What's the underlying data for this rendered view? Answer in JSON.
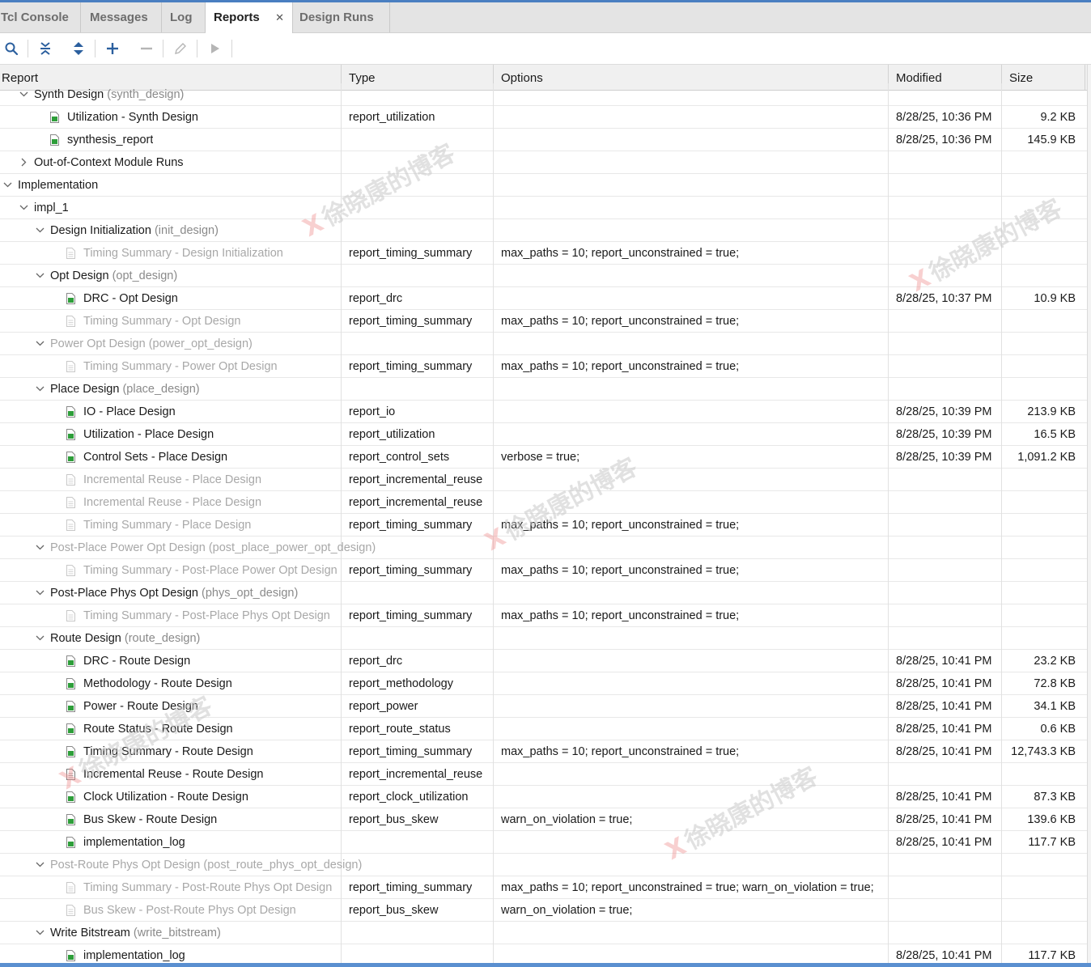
{
  "tabs": [
    {
      "label": "Tcl Console",
      "active": false
    },
    {
      "label": "Messages",
      "active": false
    },
    {
      "label": "Log",
      "active": false
    },
    {
      "label": "Reports",
      "active": true,
      "closable": true
    },
    {
      "label": "Design Runs",
      "active": false
    }
  ],
  "toolbar": {
    "buttons": [
      {
        "icon": "search-icon",
        "enabled": true
      },
      {
        "icon": "collapse-all-icon",
        "enabled": true
      },
      {
        "icon": "expand-all-icon",
        "enabled": true
      },
      {
        "icon": "add-icon",
        "enabled": true
      },
      {
        "icon": "remove-icon",
        "enabled": false
      },
      {
        "icon": "edit-pencil-icon",
        "enabled": false
      },
      {
        "icon": "run-icon",
        "enabled": false
      }
    ]
  },
  "columns": {
    "report": "Report",
    "type": "Type",
    "options": "Options",
    "modified": "Modified",
    "size": "Size"
  },
  "rows": [
    {
      "level": 1,
      "kind": "group",
      "expanded": true,
      "name": "Synth Design",
      "sub": "(synth_design)"
    },
    {
      "level": 2,
      "kind": "file",
      "status": "generated",
      "name": "Utilization - Synth Design",
      "type": "report_utilization",
      "options": "",
      "modified": "8/28/25, 10:36 PM",
      "size": "9.2 KB"
    },
    {
      "level": 2,
      "kind": "file",
      "status": "generated",
      "name": "synthesis_report",
      "type": "",
      "options": "",
      "modified": "8/28/25, 10:36 PM",
      "size": "145.9 KB"
    },
    {
      "level": 1,
      "kind": "group",
      "expanded": false,
      "name": "Out-of-Context Module Runs",
      "sub": ""
    },
    {
      "level": 0,
      "kind": "group",
      "expanded": true,
      "name": "Implementation",
      "sub": ""
    },
    {
      "level": 1,
      "kind": "group",
      "expanded": true,
      "name": "impl_1",
      "sub": ""
    },
    {
      "level": 2,
      "kind": "group",
      "expanded": true,
      "name": "Design Initialization",
      "sub": "(init_design)"
    },
    {
      "level": 3,
      "kind": "file",
      "status": "disabled",
      "name": "Timing Summary - Design Initialization",
      "type": "report_timing_summary",
      "options": "max_paths = 10; report_unconstrained = true;",
      "modified": "",
      "size": ""
    },
    {
      "level": 2,
      "kind": "group",
      "expanded": true,
      "name": "Opt Design",
      "sub": "(opt_design)"
    },
    {
      "level": 3,
      "kind": "file",
      "status": "generated",
      "name": "DRC - Opt Design",
      "type": "report_drc",
      "options": "",
      "modified": "8/28/25, 10:37 PM",
      "size": "10.9 KB"
    },
    {
      "level": 3,
      "kind": "file",
      "status": "disabled",
      "name": "Timing Summary - Opt Design",
      "type": "report_timing_summary",
      "options": "max_paths = 10; report_unconstrained = true;",
      "modified": "",
      "size": ""
    },
    {
      "level": 2,
      "kind": "group",
      "expanded": true,
      "disabled": true,
      "name": "Power Opt Design",
      "sub": "(power_opt_design)"
    },
    {
      "level": 3,
      "kind": "file",
      "status": "disabled",
      "name": "Timing Summary - Power Opt Design",
      "type": "report_timing_summary",
      "options": "max_paths = 10; report_unconstrained = true;",
      "modified": "",
      "size": ""
    },
    {
      "level": 2,
      "kind": "group",
      "expanded": true,
      "name": "Place Design",
      "sub": "(place_design)"
    },
    {
      "level": 3,
      "kind": "file",
      "status": "generated",
      "name": "IO - Place Design",
      "type": "report_io",
      "options": "",
      "modified": "8/28/25, 10:39 PM",
      "size": "213.9 KB"
    },
    {
      "level": 3,
      "kind": "file",
      "status": "generated",
      "name": "Utilization - Place Design",
      "type": "report_utilization",
      "options": "",
      "modified": "8/28/25, 10:39 PM",
      "size": "16.5 KB"
    },
    {
      "level": 3,
      "kind": "file",
      "status": "generated",
      "name": "Control Sets - Place Design",
      "type": "report_control_sets",
      "options": "verbose = true;",
      "modified": "8/28/25, 10:39 PM",
      "size": "1,091.2 KB"
    },
    {
      "level": 3,
      "kind": "file",
      "status": "disabled",
      "name": "Incremental Reuse - Place Design",
      "type": "report_incremental_reuse",
      "options": "",
      "modified": "",
      "size": ""
    },
    {
      "level": 3,
      "kind": "file",
      "status": "disabled",
      "name": "Incremental Reuse - Place Design",
      "type": "report_incremental_reuse",
      "options": "",
      "modified": "",
      "size": ""
    },
    {
      "level": 3,
      "kind": "file",
      "status": "disabled",
      "name": "Timing Summary - Place Design",
      "type": "report_timing_summary",
      "options": "max_paths = 10; report_unconstrained = true;",
      "modified": "",
      "size": ""
    },
    {
      "level": 2,
      "kind": "group",
      "expanded": true,
      "disabled": true,
      "name": "Post-Place Power Opt Design",
      "sub": "(post_place_power_opt_design)"
    },
    {
      "level": 3,
      "kind": "file",
      "status": "disabled",
      "name": "Timing Summary - Post-Place Power Opt Design",
      "type": "report_timing_summary",
      "options": "max_paths = 10; report_unconstrained = true;",
      "modified": "",
      "size": ""
    },
    {
      "level": 2,
      "kind": "group",
      "expanded": true,
      "name": "Post-Place Phys Opt Design",
      "sub": "(phys_opt_design)"
    },
    {
      "level": 3,
      "kind": "file",
      "status": "disabled",
      "name": "Timing Summary - Post-Place Phys Opt Design",
      "type": "report_timing_summary",
      "options": "max_paths = 10; report_unconstrained = true;",
      "modified": "",
      "size": ""
    },
    {
      "level": 2,
      "kind": "group",
      "expanded": true,
      "name": "Route Design",
      "sub": "(route_design)"
    },
    {
      "level": 3,
      "kind": "file",
      "status": "generated",
      "name": "DRC - Route Design",
      "type": "report_drc",
      "options": "",
      "modified": "8/28/25, 10:41 PM",
      "size": "23.2 KB"
    },
    {
      "level": 3,
      "kind": "file",
      "status": "generated",
      "name": "Methodology - Route Design",
      "type": "report_methodology",
      "options": "",
      "modified": "8/28/25, 10:41 PM",
      "size": "72.8 KB"
    },
    {
      "level": 3,
      "kind": "file",
      "status": "generated",
      "name": "Power - Route Design",
      "type": "report_power",
      "options": "",
      "modified": "8/28/25, 10:41 PM",
      "size": "34.1 KB"
    },
    {
      "level": 3,
      "kind": "file",
      "status": "generated",
      "name": "Route Status - Route Design",
      "type": "report_route_status",
      "options": "",
      "modified": "8/28/25, 10:41 PM",
      "size": "0.6 KB"
    },
    {
      "level": 3,
      "kind": "file",
      "status": "generated",
      "name": "Timing Summary - Route Design",
      "type": "report_timing_summary",
      "options": "max_paths = 10; report_unconstrained = true;",
      "modified": "8/28/25, 10:41 PM",
      "size": "12,743.3 KB"
    },
    {
      "level": 3,
      "kind": "file",
      "status": "enabled",
      "name": "Incremental Reuse - Route Design",
      "type": "report_incremental_reuse",
      "options": "",
      "modified": "",
      "size": ""
    },
    {
      "level": 3,
      "kind": "file",
      "status": "generated",
      "name": "Clock Utilization - Route Design",
      "type": "report_clock_utilization",
      "options": "",
      "modified": "8/28/25, 10:41 PM",
      "size": "87.3 KB"
    },
    {
      "level": 3,
      "kind": "file",
      "status": "generated",
      "name": "Bus Skew - Route Design",
      "type": "report_bus_skew",
      "options": "warn_on_violation = true;",
      "modified": "8/28/25, 10:41 PM",
      "size": "139.6 KB"
    },
    {
      "level": 3,
      "kind": "file",
      "status": "generated",
      "name": "implementation_log",
      "type": "",
      "options": "",
      "modified": "8/28/25, 10:41 PM",
      "size": "117.7 KB"
    },
    {
      "level": 2,
      "kind": "group",
      "expanded": true,
      "disabled": true,
      "name": "Post-Route Phys Opt Design",
      "sub": "(post_route_phys_opt_design)"
    },
    {
      "level": 3,
      "kind": "file",
      "status": "disabled",
      "name": "Timing Summary - Post-Route Phys Opt Design",
      "type": "report_timing_summary",
      "options": "max_paths = 10; report_unconstrained = true; warn_on_violation = true;",
      "modified": "",
      "size": ""
    },
    {
      "level": 3,
      "kind": "file",
      "status": "disabled",
      "name": "Bus Skew - Post-Route Phys Opt Design",
      "type": "report_bus_skew",
      "options": "warn_on_violation = true;",
      "modified": "",
      "size": ""
    },
    {
      "level": 2,
      "kind": "group",
      "expanded": true,
      "name": "Write Bitstream",
      "sub": "(write_bitstream)"
    },
    {
      "level": 3,
      "kind": "file",
      "status": "generated",
      "name": "implementation_log",
      "type": "",
      "options": "",
      "modified": "8/28/25, 10:41 PM",
      "size": "117.7 KB"
    }
  ],
  "watermark": {
    "text": "徐晓康的博客"
  },
  "colors": {
    "accent": "#4a7fc1",
    "generated_icon": "#2e9e3a",
    "disabled_text": "#a8a8a8",
    "sub_text": "#8a8a8a"
  }
}
